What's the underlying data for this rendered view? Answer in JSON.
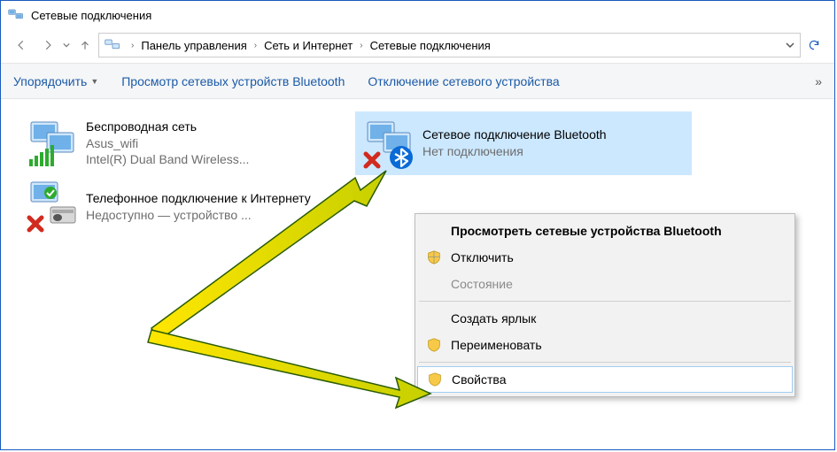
{
  "window": {
    "title": "Сетевые подключения"
  },
  "breadcrumb": {
    "p0": "Панель управления",
    "p1": "Сеть и Интернет",
    "p2": "Сетевые подключения"
  },
  "toolbar": {
    "organize": "Упорядочить",
    "view_bt": "Просмотр сетевых устройств Bluetooth",
    "disable": "Отключение сетевого устройства",
    "more": "»"
  },
  "connections": [
    {
      "name": "Беспроводная сеть",
      "sub1": "Asus_wifi",
      "sub2": "Intel(R) Dual Band Wireless...",
      "status": "wifi"
    },
    {
      "name": "Сетевое подключение Bluetooth",
      "sub1": "Нет подключения",
      "sub2": "",
      "status": "bt-disconnected",
      "selected": true
    },
    {
      "name": "Телефонное подключение к Интернету",
      "sub1": "Недоступно — устройство ...",
      "sub2": "",
      "status": "dialup-disabled"
    }
  ],
  "context_menu": {
    "view_bt_devices": "Просмотреть сетевые устройства Bluetooth",
    "disable": "Отключить",
    "status": "Состояние",
    "create_shortcut": "Создать ярлык",
    "rename": "Переименовать",
    "properties": "Свойства"
  }
}
